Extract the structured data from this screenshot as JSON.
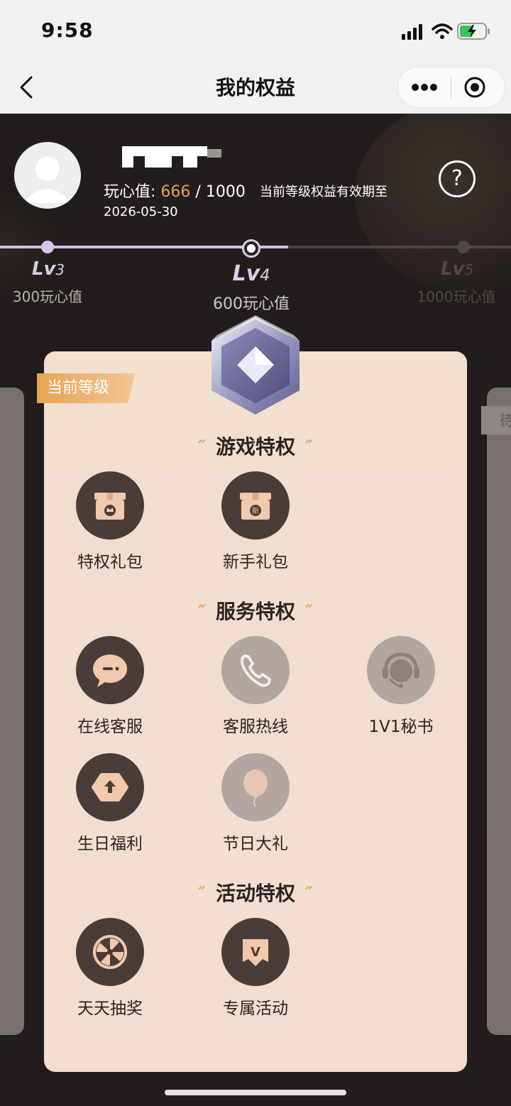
{
  "status_bar": {
    "time": "9:58"
  },
  "nav": {
    "title": "我的权益",
    "back_icon": "chevron-left-icon",
    "more_icon": "more-dots-icon",
    "target_icon": "target-circle-icon"
  },
  "profile": {
    "stat_label": "玩心值:",
    "current_points": "666",
    "separator": " / ",
    "max_points": "1000",
    "expire_label": "当前等级权益有效期至",
    "expire_date": "2026-05-30",
    "help_icon": "?"
  },
  "levels": [
    {
      "lv_prefix": "Lv",
      "lv_num": "3",
      "points": "300玩心值"
    },
    {
      "lv_prefix": "Lv",
      "lv_num": "4",
      "points": "600玩心值"
    },
    {
      "lv_prefix": "Lv",
      "lv_num": "5",
      "points": "1000玩心值"
    }
  ],
  "current_tag": "当前等级",
  "right_tag": "待",
  "sections": [
    {
      "title": "游戏特权",
      "items": [
        {
          "label": "特权礼包",
          "icon": "gift-crown-icon"
        },
        {
          "label": "新手礼包",
          "icon": "gift-new-icon"
        }
      ]
    },
    {
      "title": "服务特权",
      "items": [
        {
          "label": "在线客服",
          "icon": "chat-bubble-icon"
        },
        {
          "label": "客服热线",
          "icon": "phone-icon"
        },
        {
          "label": "1V1秘书",
          "icon": "headset-icon"
        },
        {
          "label": "生日福利",
          "icon": "birthday-icon"
        },
        {
          "label": "节日大礼",
          "icon": "balloon-icon"
        }
      ]
    },
    {
      "title": "活动特权",
      "items": [
        {
          "label": "天天抽奖",
          "icon": "lottery-wheel-icon"
        },
        {
          "label": "专属活动",
          "icon": "vip-badge-icon"
        }
      ]
    }
  ],
  "colors": {
    "accent": "#e7a157",
    "card": "#f2dfd0",
    "dark_bg": "#221d1c",
    "icon_dark": "#4a3d39",
    "icon_light": "#b2a6a0"
  }
}
